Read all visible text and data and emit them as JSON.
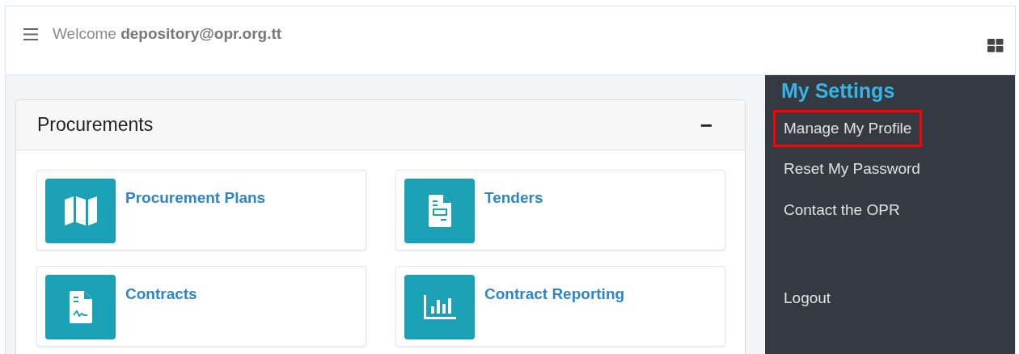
{
  "header": {
    "welcome": "Welcome",
    "user": "depository@opr.org.tt"
  },
  "panel": {
    "title": "Procurements",
    "collapse": "−",
    "tiles": [
      {
        "label": "Procurement Plans",
        "kind": "map"
      },
      {
        "label": "Tenders",
        "kind": "form"
      },
      {
        "label": "Contracts",
        "kind": "signed"
      },
      {
        "label": "Contract Reporting",
        "kind": "chart"
      }
    ]
  },
  "sidebar": {
    "title": "My Settings",
    "items": [
      {
        "label": "Manage My Profile",
        "highlighted": true,
        "kind": "link"
      },
      {
        "label": "Reset My Password",
        "highlighted": false,
        "kind": "link"
      },
      {
        "label": "Contact the OPR",
        "highlighted": false,
        "kind": "link"
      },
      {
        "label": "Logout",
        "highlighted": false,
        "kind": "logout"
      }
    ]
  }
}
